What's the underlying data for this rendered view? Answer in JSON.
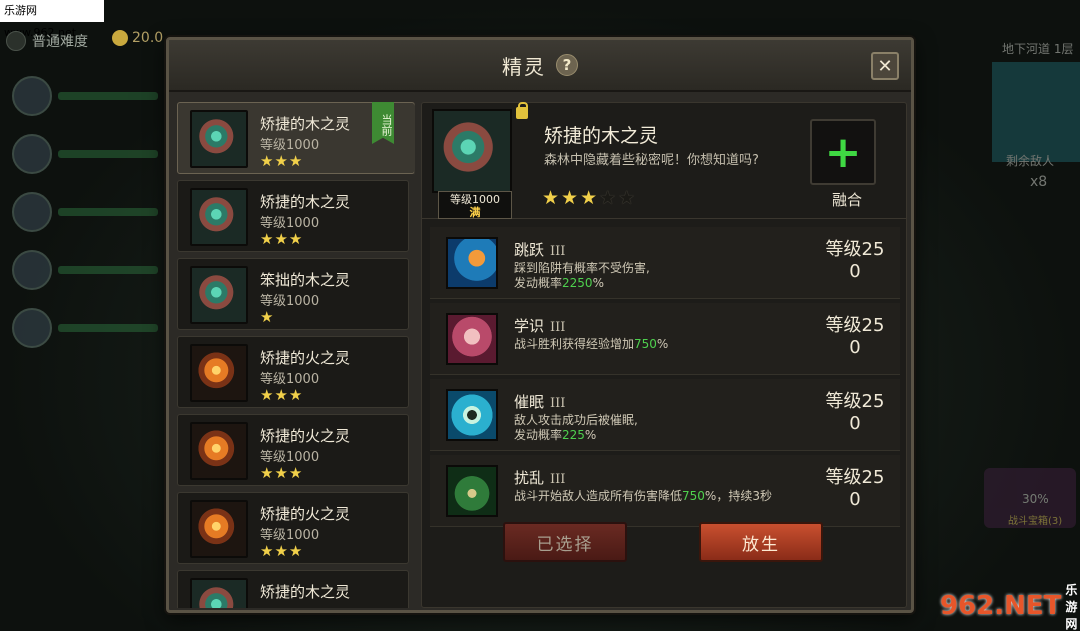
{
  "watermark_top": "乐游网 www.962.net",
  "background": {
    "difficulty": "普通难度",
    "coins": "20.0",
    "dungeon": "地下河道 1层",
    "remaining_enemies_label": "剩余敌人",
    "remaining_enemies_count": "x8",
    "chest_percent": "30%",
    "chest_label": "战斗宝箱(3)"
  },
  "dialog": {
    "title": "精灵",
    "help_glyph": "?",
    "close_glyph": "✕"
  },
  "spirit_list": [
    {
      "name": "矫捷的木之灵",
      "level": "等级1000",
      "stars": "★★★",
      "element": "wood",
      "current": true,
      "current_tag": "当前"
    },
    {
      "name": "矫捷的木之灵",
      "level": "等级1000",
      "stars": "★★★",
      "element": "wood"
    },
    {
      "name": "笨拙的木之灵",
      "level": "等级1000",
      "stars": "★",
      "element": "wood"
    },
    {
      "name": "矫捷的火之灵",
      "level": "等级1000",
      "stars": "★★★",
      "element": "fire"
    },
    {
      "name": "矫捷的火之灵",
      "level": "等级1000",
      "stars": "★★★",
      "element": "fire"
    },
    {
      "name": "矫捷的火之灵",
      "level": "等级1000",
      "stars": "★★★",
      "element": "fire"
    },
    {
      "name": "矫捷的木之灵",
      "level": "",
      "stars": "",
      "element": "wood"
    }
  ],
  "detail": {
    "name": "矫捷的木之灵",
    "description": "森林中隐藏着些秘密呢！你想知道吗?",
    "level": "等级1000",
    "max_label": "满",
    "stars_on": "★★★",
    "stars_off": "★★",
    "fuse_label": "融合"
  },
  "skills": [
    {
      "name": "跳跃",
      "rank": "III",
      "icon": "jump-icon",
      "desc_1": "踩到陷阱有概率不受伤害,",
      "desc_2_prefix": "发动概率",
      "desc_2_value": "2250",
      "desc_2_suffix": "%",
      "level": "等级250"
    },
    {
      "name": "学识",
      "rank": "III",
      "icon": "learn-icon",
      "desc_1": "",
      "desc_2_prefix": "战斗胜利获得经验增加",
      "desc_2_value": "750",
      "desc_2_suffix": "%",
      "level": "等级250"
    },
    {
      "name": "催眠",
      "rank": "III",
      "icon": "hypnosis-icon",
      "desc_1": "敌人攻击成功后被催眠,",
      "desc_2_prefix": "发动概率",
      "desc_2_value": "225",
      "desc_2_suffix": "%",
      "level": "等级250"
    },
    {
      "name": "扰乱",
      "rank": "III",
      "icon": "chaos-icon",
      "desc_1": "",
      "desc_2_prefix": "战斗开始敌人造成所有伤害降低",
      "desc_2_value": "750",
      "desc_2_suffix": "%，持续3秒",
      "level": "等级250"
    }
  ],
  "buttons": {
    "selected": "已选择",
    "release": "放生"
  },
  "watermark_br": {
    "big": "962.NET",
    "small": "乐游网"
  }
}
